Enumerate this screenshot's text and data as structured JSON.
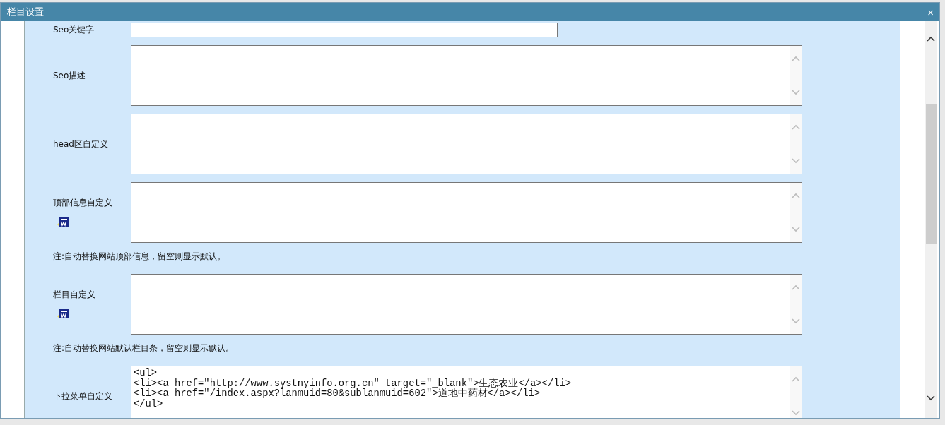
{
  "dialog": {
    "title": "栏目设置",
    "close": "×"
  },
  "fields": [
    {
      "kind": "input",
      "label": "Seo关键字",
      "editor": false
    },
    {
      "kind": "textarea",
      "label": "Seo描述",
      "editor": false
    },
    {
      "kind": "textarea",
      "label": "head区自定义",
      "editor": false
    },
    {
      "kind": "textarea",
      "label": "顶部信息自定义",
      "editor": true,
      "note": "注:自动替换网站顶部信息，留空则显示默认。"
    },
    {
      "kind": "textarea",
      "label": "栏目自定义",
      "editor": true,
      "note": "注:自动替换网站默认栏目条，留空则显示默认。"
    },
    {
      "kind": "textarea",
      "label": "下拉菜单自定义",
      "editor": false,
      "value": "<ul>\n<li><a href=\"http://www.systnyinfo.org.cn\" target=\"_blank\">生态农业</a></li>\n<li><a href=\"/index.aspx?lanmuid=80&sublanmuid=602\">道地中药材</a></li>\n</ul>"
    }
  ]
}
